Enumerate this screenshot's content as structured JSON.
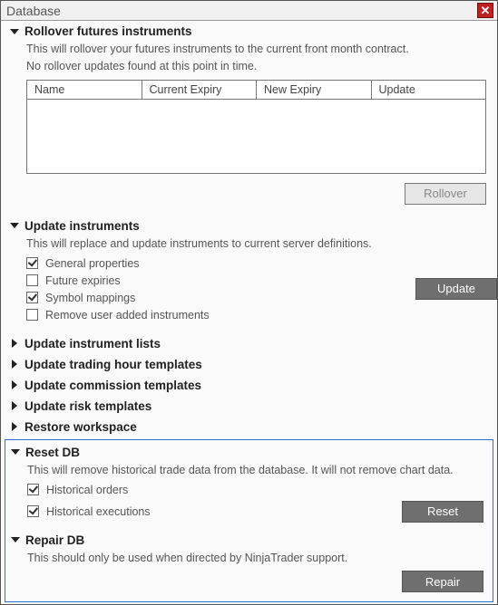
{
  "window": {
    "title": "Database"
  },
  "rollover": {
    "title": "Rollover futures instruments",
    "desc1": "This will rollover your futures instruments to the current front month contract.",
    "desc2": "No rollover updates found at this point in time.",
    "cols": {
      "name": "Name",
      "current": "Current Expiry",
      "new": "New Expiry",
      "update": "Update"
    },
    "button": "Rollover"
  },
  "update_instruments": {
    "title": "Update instruments",
    "desc": "This will replace and update instruments to current server definitions.",
    "opts": {
      "general": {
        "label": "General properties",
        "checked": true
      },
      "future_exp": {
        "label": "Future expiries",
        "checked": false
      },
      "symbol_map": {
        "label": "Symbol mappings",
        "checked": true
      },
      "remove_user": {
        "label": "Remove user added instruments",
        "checked": false
      }
    },
    "button": "Update"
  },
  "collapsed": {
    "lists": "Update instrument lists",
    "trading_hours": "Update trading hour templates",
    "commission": "Update commission templates",
    "risk": "Update risk templates",
    "restore": "Restore workspace"
  },
  "reset": {
    "title": "Reset DB",
    "desc": "This will remove historical trade data from the database. It will not remove chart data.",
    "opts": {
      "orders": {
        "label": "Historical orders",
        "checked": true
      },
      "executions": {
        "label": "Historical executions",
        "checked": true
      }
    },
    "button": "Reset"
  },
  "repair": {
    "title": "Repair DB",
    "desc": "This should only be used when directed by NinjaTrader support.",
    "button": "Repair"
  }
}
